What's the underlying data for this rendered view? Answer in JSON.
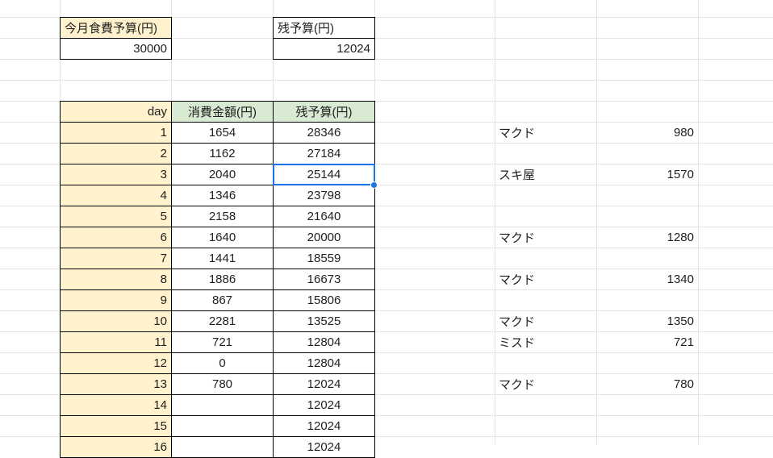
{
  "budget": {
    "label": "今月食費予算(円)",
    "value": "30000"
  },
  "remaining": {
    "label": "残予算(円)",
    "value": "12024"
  },
  "table": {
    "headers": [
      "day",
      "消費金額(円)",
      "残予算(円)"
    ],
    "rows": [
      {
        "day": "1",
        "spent": "1654",
        "remain": "28346"
      },
      {
        "day": "2",
        "spent": "1162",
        "remain": "27184"
      },
      {
        "day": "3",
        "spent": "2040",
        "remain": "25144"
      },
      {
        "day": "4",
        "spent": "1346",
        "remain": "23798"
      },
      {
        "day": "5",
        "spent": "2158",
        "remain": "21640"
      },
      {
        "day": "6",
        "spent": "1640",
        "remain": "20000"
      },
      {
        "day": "7",
        "spent": "1441",
        "remain": "18559"
      },
      {
        "day": "8",
        "spent": "1886",
        "remain": "16673"
      },
      {
        "day": "9",
        "spent": "867",
        "remain": "15806"
      },
      {
        "day": "10",
        "spent": "2281",
        "remain": "13525"
      },
      {
        "day": "11",
        "spent": "721",
        "remain": "12804"
      },
      {
        "day": "12",
        "spent": "0",
        "remain": "12804"
      },
      {
        "day": "13",
        "spent": "780",
        "remain": "12024"
      },
      {
        "day": "14",
        "spent": "",
        "remain": "12024"
      },
      {
        "day": "15",
        "spent": "",
        "remain": "12024"
      },
      {
        "day": "16",
        "spent": "",
        "remain": "12024"
      }
    ]
  },
  "notes": [
    {
      "row": 1,
      "shop": "マクド",
      "amount": "980"
    },
    {
      "row": 3,
      "shop": "スキ屋",
      "amount": "1570"
    },
    {
      "row": 6,
      "shop": "マクド",
      "amount": "1280"
    },
    {
      "row": 8,
      "shop": "マクド",
      "amount": "1340"
    },
    {
      "row": 10,
      "shop": "マクド",
      "amount": "1350"
    },
    {
      "row": 11,
      "shop": "ミスド",
      "amount": "721"
    },
    {
      "row": 13,
      "shop": "マクド",
      "amount": "780"
    }
  ],
  "selection": {
    "day": "3",
    "column": "残予算(円)"
  },
  "colors": {
    "header_yellow": "#fff2cc",
    "header_green": "#d9ead3",
    "selection_blue": "#1a73e8",
    "gridline": "#e2e3e3"
  }
}
